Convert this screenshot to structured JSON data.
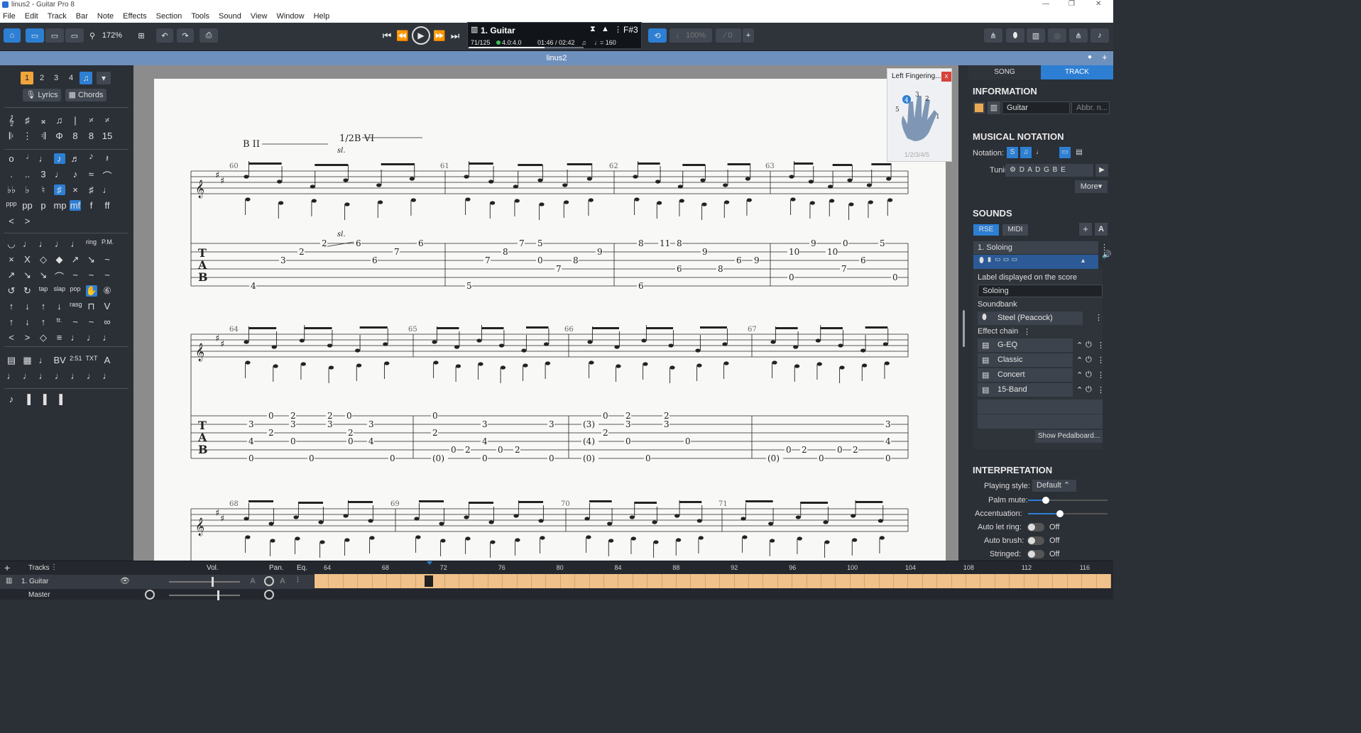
{
  "window": {
    "title": "linus2 - Guitar Pro 8"
  },
  "menu": [
    "File",
    "Edit",
    "Track",
    "Bar",
    "Note",
    "Effects",
    "Section",
    "Tools",
    "Sound",
    "View",
    "Window",
    "Help"
  ],
  "toolbar": {
    "zoom": "172%"
  },
  "lcd": {
    "track": "1. Guitar",
    "bar": "71/125",
    "signature": "4.0:4.0",
    "time": "01:46 / 02:42",
    "tempo": "= 160",
    "key": "F#3"
  },
  "file": {
    "name": "linus2"
  },
  "palette": {
    "voices": [
      "1",
      "2",
      "3",
      "4"
    ],
    "lyrics": "Lyrics",
    "chords": "Chords"
  },
  "score": {
    "bars_row1": [
      "60",
      "61",
      "62",
      "63"
    ],
    "bars_row2": [
      "64",
      "65",
      "66",
      "67"
    ],
    "bars_row3": [
      "68",
      "69",
      "70",
      "71"
    ],
    "annot1": "B II",
    "annot2": "1/2B VI",
    "slide": "sl."
  },
  "finger_popup": {
    "title": "Left Fingering...",
    "close": "x",
    "fingers": "1/2/3/4/5",
    "labels": [
      "4",
      "3",
      "2",
      "5",
      "1"
    ]
  },
  "right": {
    "tabs": [
      "SONG",
      "TRACK"
    ],
    "information": "INFORMATION",
    "track_name": "Guitar",
    "abbr_placeholder": "Abbr. n...",
    "musical_notation": "MUSICAL NOTATION",
    "notation_label": "Notation:",
    "tuning_label": "Tuning:",
    "tuning_value": "D A D G B E",
    "more": "More",
    "sounds": "SOUNDS",
    "rse": "RSE",
    "midi": "MIDI",
    "sound_name": "1. Soloing",
    "label_caption": "Label displayed on the score",
    "label_value": "Soloing",
    "soundbank_caption": "Soundbank",
    "soundbank_value": "Steel (Peacock)",
    "effect_chain": "Effect chain",
    "effects": [
      "G-EQ",
      "Classic",
      "Concert",
      "15-Band"
    ],
    "show_pedalboard": "Show Pedalboard...",
    "interpretation": "INTERPRETATION",
    "playing_style_label": "Playing style:",
    "playing_style": "Default",
    "palm_mute": "Palm mute:",
    "accentuation": "Accentuation:",
    "auto_let_ring": "Auto let ring:",
    "auto_brush": "Auto brush:",
    "stringed": "Stringed:",
    "off": "Off"
  },
  "bottom": {
    "tracks": "Tracks",
    "vol": "Vol.",
    "pan": "Pan.",
    "eq": "Eq.",
    "track1": "1. Guitar",
    "master": "Master",
    "ticks": [
      "64",
      "68",
      "72",
      "76",
      "80",
      "84",
      "88",
      "92",
      "96",
      "100",
      "104",
      "108",
      "112",
      "116"
    ]
  }
}
